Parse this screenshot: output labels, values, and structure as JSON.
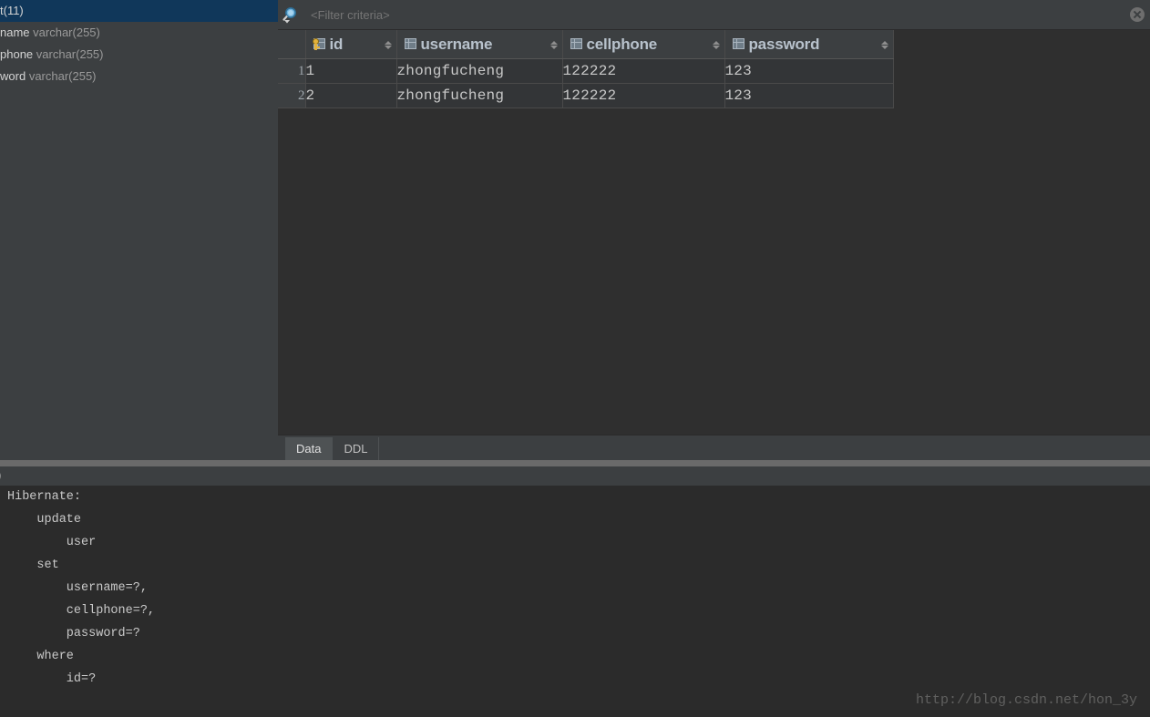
{
  "sidebar": {
    "items": [
      {
        "name": "t(11)",
        "type": "",
        "selected": true
      },
      {
        "name": "name",
        "type": "varchar(255)",
        "selected": false
      },
      {
        "name": "phone",
        "type": "varchar(255)",
        "selected": false
      },
      {
        "name": "word",
        "type": "varchar(255)",
        "selected": false
      }
    ]
  },
  "filter": {
    "icon": "search-icon",
    "placeholder": "<Filter criteria>",
    "value": "",
    "close_icon": "close-icon"
  },
  "grid": {
    "row_number_header": "",
    "columns": [
      {
        "label": "id",
        "icon": "primary-key-column-icon",
        "sortable": true
      },
      {
        "label": "username",
        "icon": "column-icon",
        "sortable": true
      },
      {
        "label": "cellphone",
        "icon": "column-icon",
        "sortable": true
      },
      {
        "label": "password",
        "icon": "column-icon",
        "sortable": true
      }
    ],
    "rows": [
      {
        "num": "1",
        "id": "1",
        "username": "zhongfucheng",
        "cellphone": "122222",
        "password": "123"
      },
      {
        "num": "2",
        "id": "2",
        "username": "zhongfucheng",
        "cellphone": "122222",
        "password": "123"
      }
    ]
  },
  "tabs": [
    {
      "label": "Data",
      "active": true
    },
    {
      "label": "DDL",
      "active": false
    }
  ],
  "console": {
    "strip_text": ")",
    "lines": [
      "Hibernate: ",
      "    update",
      "        user ",
      "    set",
      "        username=?,",
      "        cellphone=?,",
      "        password=?",
      "    where",
      "        id=?"
    ]
  },
  "watermark": "http://blog.csdn.net/hon_3y",
  "colors": {
    "selection": "#10375a",
    "panel": "#3c3f41",
    "editor": "#2b2b2b",
    "grid_cell": "#333537",
    "accent_key": "#e3b23c",
    "search_blue": "#5a9ec9"
  }
}
